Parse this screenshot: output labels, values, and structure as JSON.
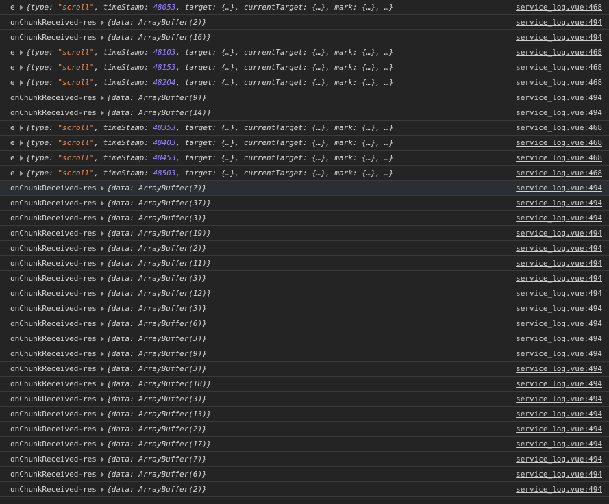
{
  "colors": {
    "background": "#242424",
    "row_border": "#3a3a3a",
    "highlight_row": "#2b2e33",
    "text": "#d5d5d5",
    "string": "#f28b54",
    "number": "#9980ff"
  },
  "icons": {
    "expand": "disclosure-triangle-right-icon"
  },
  "rows": [
    {
      "kind": "event",
      "prefix": "e",
      "type": "\"scroll\"",
      "timeStamp": "48053",
      "source": "service_log.vue:468"
    },
    {
      "kind": "chunk",
      "prefix": "onChunkReceived-res",
      "size": "2",
      "source": "service_log.vue:494"
    },
    {
      "kind": "chunk",
      "prefix": "onChunkReceived-res",
      "size": "16",
      "source": "service_log.vue:494"
    },
    {
      "kind": "event",
      "prefix": "e",
      "type": "\"scroll\"",
      "timeStamp": "48103",
      "source": "service_log.vue:468"
    },
    {
      "kind": "event",
      "prefix": "e",
      "type": "\"scroll\"",
      "timeStamp": "48153",
      "source": "service_log.vue:468"
    },
    {
      "kind": "event",
      "prefix": "e",
      "type": "\"scroll\"",
      "timeStamp": "48204",
      "source": "service_log.vue:468"
    },
    {
      "kind": "chunk",
      "prefix": "onChunkReceived-res",
      "size": "9",
      "source": "service_log.vue:494"
    },
    {
      "kind": "chunk",
      "prefix": "onChunkReceived-res",
      "size": "14",
      "source": "service_log.vue:494"
    },
    {
      "kind": "event",
      "prefix": "e",
      "type": "\"scroll\"",
      "timeStamp": "48353",
      "source": "service_log.vue:468"
    },
    {
      "kind": "event",
      "prefix": "e",
      "type": "\"scroll\"",
      "timeStamp": "48403",
      "source": "service_log.vue:468"
    },
    {
      "kind": "event",
      "prefix": "e",
      "type": "\"scroll\"",
      "timeStamp": "48453",
      "source": "service_log.vue:468"
    },
    {
      "kind": "event",
      "prefix": "e",
      "type": "\"scroll\"",
      "timeStamp": "48503",
      "source": "service_log.vue:468"
    },
    {
      "kind": "chunk",
      "prefix": "onChunkReceived-res",
      "size": "7",
      "source": "service_log.vue:494",
      "highlight": true
    },
    {
      "kind": "chunk",
      "prefix": "onChunkReceived-res",
      "size": "37",
      "source": "service_log.vue:494"
    },
    {
      "kind": "chunk",
      "prefix": "onChunkReceived-res",
      "size": "3",
      "source": "service_log.vue:494"
    },
    {
      "kind": "chunk",
      "prefix": "onChunkReceived-res",
      "size": "19",
      "source": "service_log.vue:494"
    },
    {
      "kind": "chunk",
      "prefix": "onChunkReceived-res",
      "size": "2",
      "source": "service_log.vue:494"
    },
    {
      "kind": "chunk",
      "prefix": "onChunkReceived-res",
      "size": "11",
      "source": "service_log.vue:494"
    },
    {
      "kind": "chunk",
      "prefix": "onChunkReceived-res",
      "size": "3",
      "source": "service_log.vue:494"
    },
    {
      "kind": "chunk",
      "prefix": "onChunkReceived-res",
      "size": "12",
      "source": "service_log.vue:494"
    },
    {
      "kind": "chunk",
      "prefix": "onChunkReceived-res",
      "size": "3",
      "source": "service_log.vue:494"
    },
    {
      "kind": "chunk",
      "prefix": "onChunkReceived-res",
      "size": "6",
      "source": "service_log.vue:494"
    },
    {
      "kind": "chunk",
      "prefix": "onChunkReceived-res",
      "size": "3",
      "source": "service_log.vue:494"
    },
    {
      "kind": "chunk",
      "prefix": "onChunkReceived-res",
      "size": "9",
      "source": "service_log.vue:494"
    },
    {
      "kind": "chunk",
      "prefix": "onChunkReceived-res",
      "size": "3",
      "source": "service_log.vue:494"
    },
    {
      "kind": "chunk",
      "prefix": "onChunkReceived-res",
      "size": "18",
      "source": "service_log.vue:494"
    },
    {
      "kind": "chunk",
      "prefix": "onChunkReceived-res",
      "size": "3",
      "source": "service_log.vue:494"
    },
    {
      "kind": "chunk",
      "prefix": "onChunkReceived-res",
      "size": "13",
      "source": "service_log.vue:494"
    },
    {
      "kind": "chunk",
      "prefix": "onChunkReceived-res",
      "size": "2",
      "source": "service_log.vue:494"
    },
    {
      "kind": "chunk",
      "prefix": "onChunkReceived-res",
      "size": "17",
      "source": "service_log.vue:494"
    },
    {
      "kind": "chunk",
      "prefix": "onChunkReceived-res",
      "size": "7",
      "source": "service_log.vue:494"
    },
    {
      "kind": "chunk",
      "prefix": "onChunkReceived-res",
      "size": "6",
      "source": "service_log.vue:494"
    },
    {
      "kind": "chunk",
      "prefix": "onChunkReceived-res",
      "size": "2",
      "source": "service_log.vue:494"
    }
  ]
}
